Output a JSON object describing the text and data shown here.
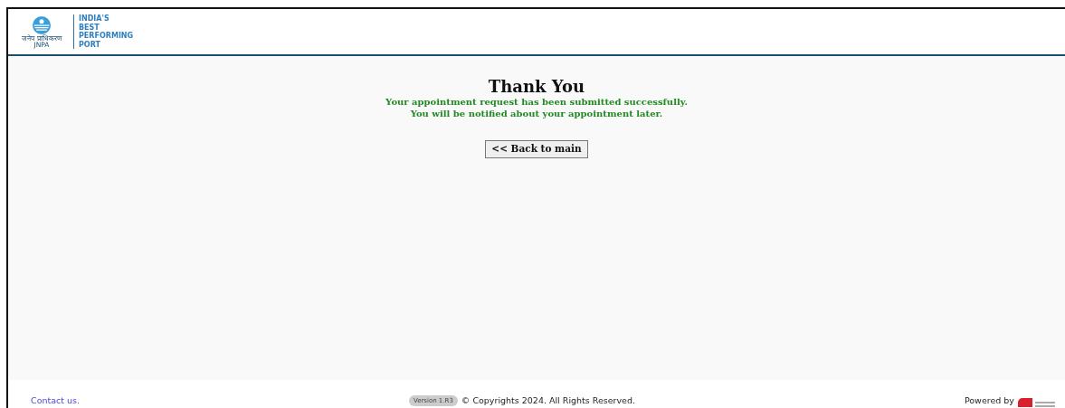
{
  "header": {
    "logo_caption": "जनेप प्राधिकरण",
    "logo_abbr": "JNPA",
    "tagline": [
      "INDIA'S",
      "BEST",
      "PERFORMING",
      "PORT"
    ]
  },
  "message": {
    "title": "Thank You",
    "lines": [
      "Your appointment request has been submitted successfully.",
      "You will be notified about your appointment later."
    ],
    "button": "<< Back to main"
  },
  "footer": {
    "contact": "Contact us.",
    "version": "Version 1.R3",
    "copyright": "© Copyrights 2024. All Rights Reserved.",
    "powered_by": "Powered by"
  }
}
